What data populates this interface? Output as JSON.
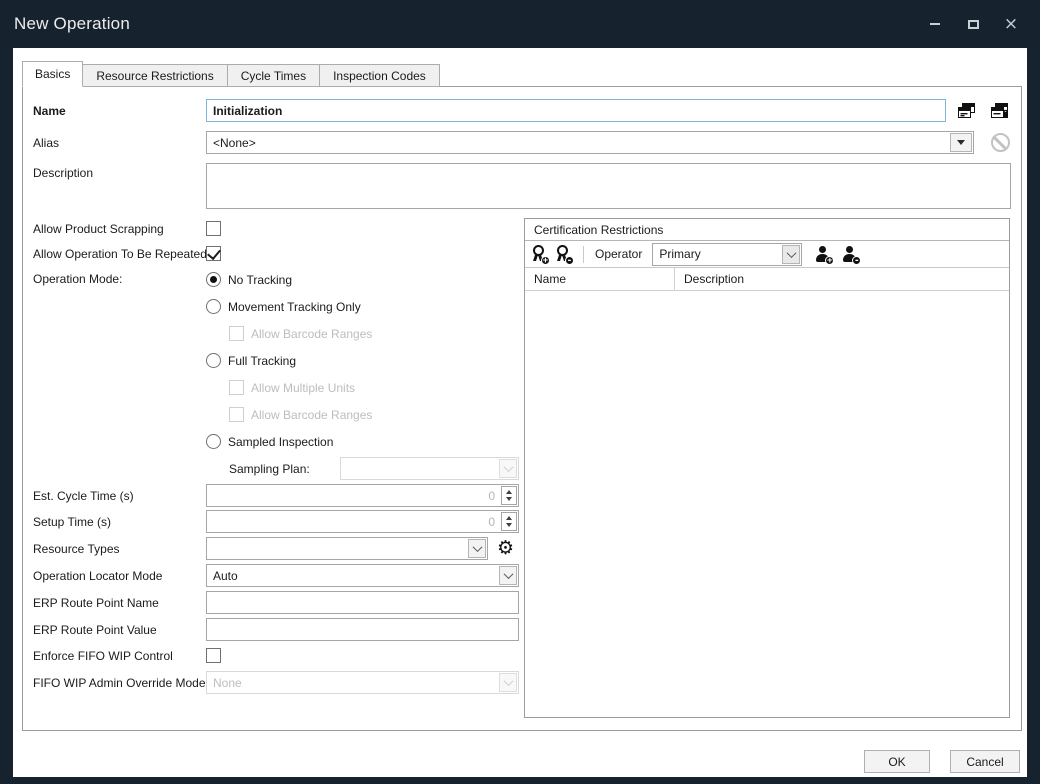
{
  "titlebar": {
    "title": "New Operation"
  },
  "tabs": {
    "items": [
      {
        "label": "Basics",
        "active": true
      },
      {
        "label": "Resource Restrictions",
        "active": false
      },
      {
        "label": "Cycle Times",
        "active": false
      },
      {
        "label": "Inspection Codes",
        "active": false
      }
    ]
  },
  "form": {
    "name_label": "Name",
    "name_value": "Initialization",
    "alias_label": "Alias",
    "alias_value": "<None>",
    "description_label": "Description",
    "description_value": "",
    "allow_product_scrapping_label": "Allow Product Scrapping",
    "allow_product_scrapping_checked": false,
    "allow_operation_repeated_label": "Allow Operation To Be Repeated",
    "allow_operation_repeated_checked": true,
    "operation_mode_label": "Operation Mode:",
    "operation_mode": {
      "no_tracking": "No Tracking",
      "no_tracking_selected": true,
      "movement_tracking": "Movement Tracking Only",
      "movement_allow_barcode": "Allow Barcode Ranges",
      "full_tracking": "Full Tracking",
      "full_allow_multiple_units": "Allow Multiple Units",
      "full_allow_barcode": "Allow Barcode Ranges",
      "sampled_inspection": "Sampled Inspection",
      "sampling_plan_label": "Sampling Plan:",
      "sampling_plan_value": ""
    },
    "est_cycle_label": "Est. Cycle Time  (s)",
    "est_cycle_value": "0",
    "setup_time_label": "Setup Time (s)",
    "setup_time_value": "0",
    "resource_types_label": "Resource Types",
    "resource_types_value": "",
    "operation_locator_label": "Operation Locator Mode",
    "operation_locator_value": "Auto",
    "erp_route_point_name_label": "ERP Route Point Name",
    "erp_route_point_name_value": "",
    "erp_route_point_value_label": "ERP Route Point Value",
    "erp_route_point_value_value": "",
    "enforce_fifo_label": "Enforce FIFO WIP Control",
    "enforce_fifo_checked": false,
    "fifo_admin_label": "FIFO WIP Admin Override Mode",
    "fifo_admin_value": "None",
    "fifo_admin_disabled": true
  },
  "certification": {
    "title": "Certification Restrictions",
    "operator_label": "Operator",
    "operator_value": "Primary",
    "columns": {
      "name": "Name",
      "description": "Description"
    },
    "rows": []
  },
  "footer": {
    "ok_label": "OK",
    "cancel_label": "Cancel"
  },
  "colors": {
    "titlebar": "#16232e",
    "focus_border": "#7eb4d8",
    "disabled_text": "#bdbdbd"
  }
}
